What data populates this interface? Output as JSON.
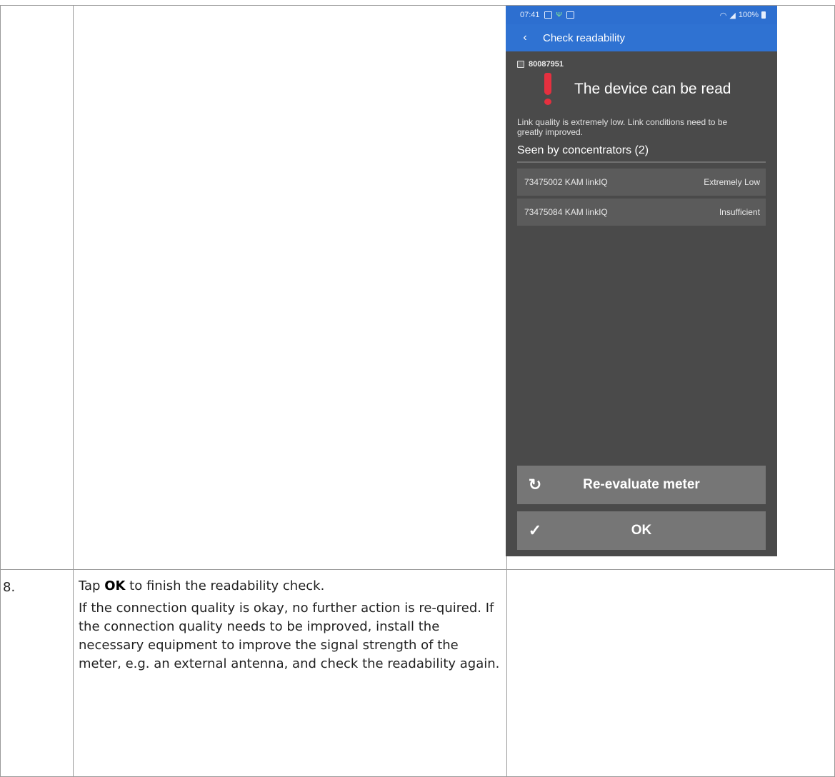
{
  "phone": {
    "status_bar": {
      "time": "07:41",
      "right": "100%",
      "icons": [
        "image-icon",
        "antenna-icon",
        "screen-icon",
        "wifi-icon",
        "signal-icon",
        "battery-icon"
      ]
    },
    "app_bar": {
      "back_icon": "chevron-left-icon",
      "title": "Check readability"
    },
    "device_id": "80087951",
    "status_icon": "exclamation-icon",
    "status_color": "#e5303f",
    "status_title": "The device can be read",
    "description": "Link quality is extremely low. Link conditions need to be greatly improved.",
    "concentrators_header": "Seen by concentrators (2)",
    "concentrators": [
      {
        "id_type": "73475002  KAM  linkIQ",
        "quality": "Extremely Low"
      },
      {
        "id_type": "73475084  KAM  linkIQ",
        "quality": "Insufficient"
      }
    ],
    "buttons": {
      "reevaluate": {
        "icon": "refresh-icon",
        "label": "Re-evaluate meter"
      },
      "ok": {
        "icon": "checkmark-icon",
        "label": "OK"
      }
    },
    "colors": {
      "app_bar": "#2f72d2",
      "background": "#4a4a4a",
      "button": "#767676"
    }
  },
  "step": {
    "number": "8.",
    "instruction_prefix": "Tap ",
    "instruction_bold": "OK",
    "instruction_suffix": " to finish the readability check.",
    "paragraph": "If the connection quality is okay, no further action is re-quired. If the connection quality needs to be improved, install the necessary equipment to improve the signal strength of the meter, e.g. an external antenna, and check the readability again."
  }
}
